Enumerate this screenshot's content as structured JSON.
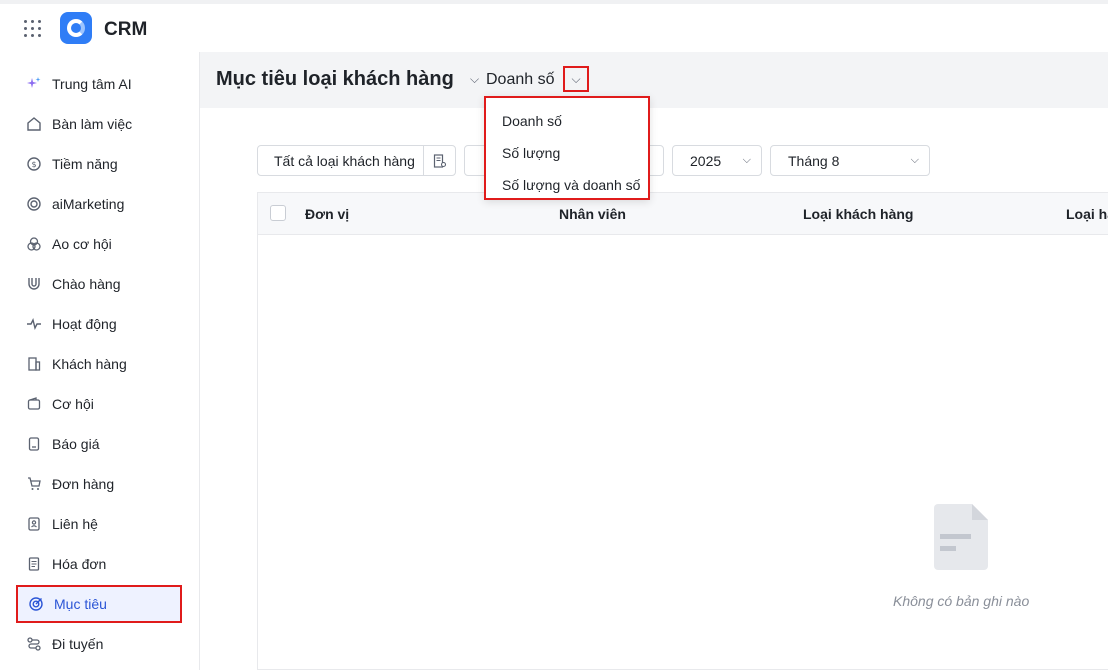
{
  "app": {
    "title": "CRM"
  },
  "sidebar": {
    "items": [
      {
        "label": "Trung tâm AI",
        "icon": "sparkle-icon"
      },
      {
        "label": "Bàn làm việc",
        "icon": "home-icon"
      },
      {
        "label": "Tiềm năng",
        "icon": "target-dollar-icon"
      },
      {
        "label": "aiMarketing",
        "icon": "radar-icon"
      },
      {
        "label": "Ao cơ hội",
        "icon": "circles-icon"
      },
      {
        "label": "Chào hàng",
        "icon": "magnet-icon"
      },
      {
        "label": "Hoạt động",
        "icon": "pulse-icon"
      },
      {
        "label": "Khách hàng",
        "icon": "building-icon"
      },
      {
        "label": "Cơ hội",
        "icon": "wallet-icon"
      },
      {
        "label": "Báo giá",
        "icon": "quote-icon"
      },
      {
        "label": "Đơn hàng",
        "icon": "cart-icon"
      },
      {
        "label": "Liên hệ",
        "icon": "contact-icon"
      },
      {
        "label": "Hóa đơn",
        "icon": "invoice-icon"
      },
      {
        "label": "Mục tiêu",
        "icon": "goal-icon",
        "active": true
      },
      {
        "label": "Đi tuyến",
        "icon": "route-icon"
      }
    ]
  },
  "header": {
    "title": "Mục tiêu loại khách hàng",
    "metric": "Doanh số"
  },
  "metric_dropdown": {
    "options": [
      "Doanh số",
      "Số lượng",
      "Số lượng và doanh số"
    ]
  },
  "filters": {
    "customer_type": "Tất cả loại khách hàng",
    "year": "2025",
    "month": "Tháng 8"
  },
  "table": {
    "columns": [
      "Đơn vị",
      "Nhân viên",
      "Loại khách hàng",
      "Loại hà"
    ]
  },
  "empty_state": {
    "message": "Không có bản ghi nào"
  },
  "colors": {
    "accent": "#2b55d6",
    "highlight": "#e01b1b",
    "header_bg": "#f3f4f6"
  }
}
